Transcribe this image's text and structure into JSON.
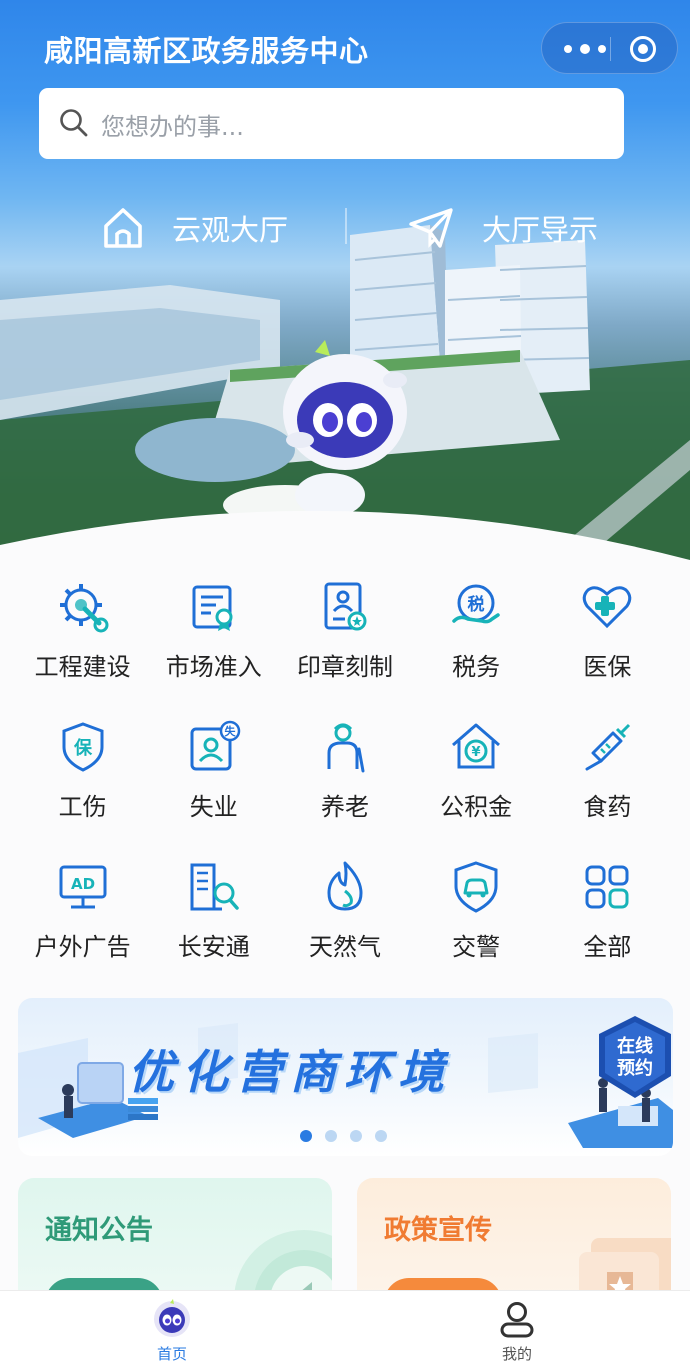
{
  "header": {
    "title": "咸阳高新区政务服务中心"
  },
  "search": {
    "placeholder": "您想办的事..."
  },
  "quick_links": [
    {
      "label": "云观大厅",
      "icon": "house-icon"
    },
    {
      "label": "大厅导示",
      "icon": "paper-plane-icon"
    }
  ],
  "services": [
    {
      "label": "工程建设",
      "icon": "gear-wrench-icon"
    },
    {
      "label": "市场准入",
      "icon": "certificate-icon"
    },
    {
      "label": "印章刻制",
      "icon": "id-seal-icon"
    },
    {
      "label": "税务",
      "icon": "tax-icon"
    },
    {
      "label": "医保",
      "icon": "heart-plus-icon"
    },
    {
      "label": "工伤",
      "icon": "shield-bao-icon"
    },
    {
      "label": "失业",
      "icon": "person-card-icon"
    },
    {
      "label": "养老",
      "icon": "elderly-icon"
    },
    {
      "label": "公积金",
      "icon": "house-yen-icon"
    },
    {
      "label": "食药",
      "icon": "syringe-icon"
    },
    {
      "label": "户外广告",
      "icon": "ad-board-icon"
    },
    {
      "label": "长安通",
      "icon": "building-search-icon"
    },
    {
      "label": "天然气",
      "icon": "flame-icon"
    },
    {
      "label": "交警",
      "icon": "police-car-shield-icon"
    },
    {
      "label": "全部",
      "icon": "grid-four-icon"
    }
  ],
  "icon_badges": {
    "tax": "税",
    "unemployment": "失",
    "injury": "保",
    "ad": "AD",
    "housing_fund": "¥"
  },
  "banner": {
    "title": "优化营商环境",
    "badge_line1": "在线",
    "badge_line2": "预约",
    "active_slide": 1,
    "slide_count": 4
  },
  "cards": {
    "notice_title": "通知公告",
    "policy_title": "政策宣传"
  },
  "tabbar": {
    "home_label": "首页",
    "mine_label": "我的"
  },
  "colors": {
    "accent": "#2a7be2",
    "notice_green": "#2f9a78",
    "policy_orange": "#f07b32"
  }
}
